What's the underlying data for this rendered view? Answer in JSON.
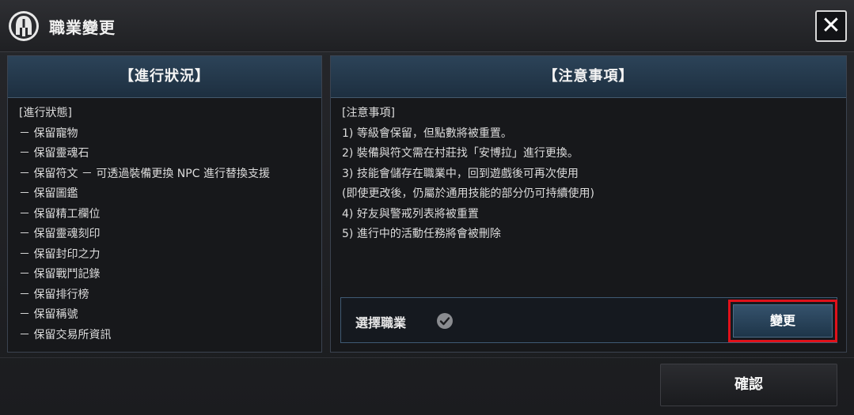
{
  "window": {
    "title": "職業變更",
    "close_label": "✕"
  },
  "left_panel": {
    "header": "【進行狀況】",
    "items": [
      "[進行狀態]",
      "－ 保留寵物",
      "－ 保留靈魂石",
      "－ 保留符文 － 可透過裝備更換 NPC 進行替換支援",
      "－ 保留圖鑑",
      "－ 保留精工欄位",
      "－ 保留靈魂刻印",
      "－ 保留封印之力",
      "－ 保留戰鬥記錄",
      "－ 保留排行榜",
      "－ 保留稱號",
      "－ 保留交易所資訊"
    ]
  },
  "right_panel": {
    "header": "【注意事項】",
    "items": [
      "[注意事項]",
      "1) 等級會保留，但點數將被重置。",
      "2) 裝備與符文需在村莊找「安博拉」進行更換。",
      "3) 技能會儲存在職業中，回到遊戲後可再次使用",
      "(即使更改後，仍屬於通用技能的部分仍可持續使用)",
      "4) 好友與警戒列表將被重置",
      "5) 進行中的活動任務將會被刪除"
    ],
    "select_label": "選擇職業",
    "change_button": "變更"
  },
  "footer": {
    "confirm_button": "確認"
  },
  "colors": {
    "header_blue": "#2c4358",
    "highlight_red": "#e0111a"
  }
}
